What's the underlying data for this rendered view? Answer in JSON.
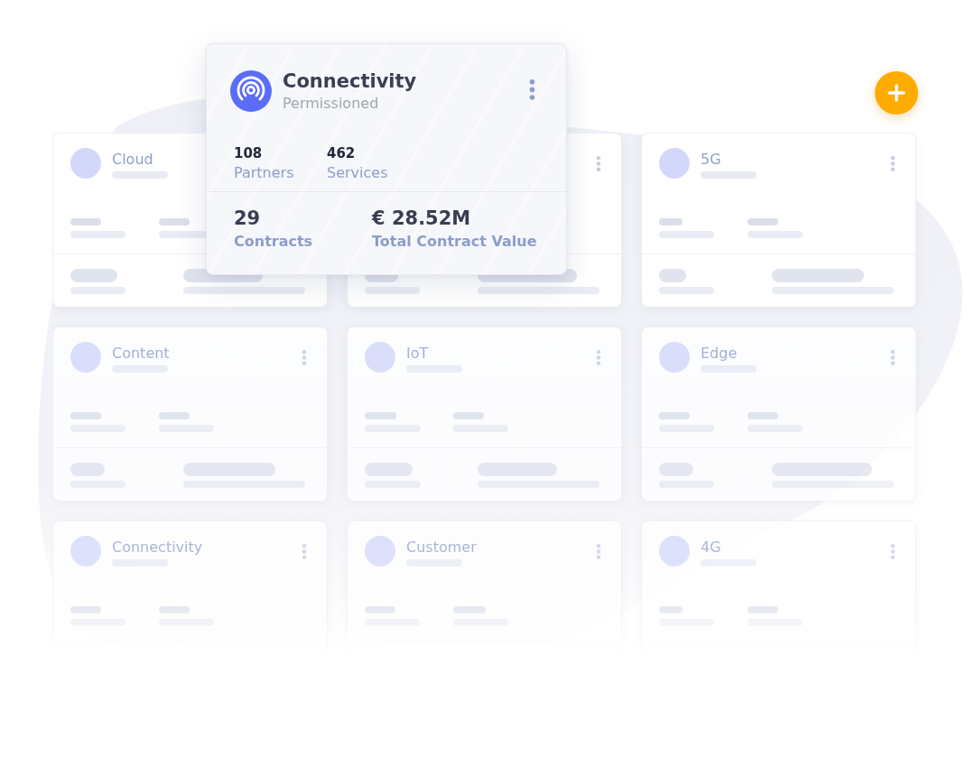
{
  "featured_card": {
    "title": "Connectivity",
    "subtitle": "Permissioned",
    "stats": [
      {
        "value": "108",
        "label": "Partners"
      },
      {
        "value": "462",
        "label": "Services"
      }
    ],
    "totals": [
      {
        "value": "29",
        "label": "Contracts"
      },
      {
        "value": "€ 28.52M",
        "label": "Total Contract Value"
      }
    ]
  },
  "cards": [
    {
      "title": "Cloud"
    },
    {
      "title": "5G"
    },
    {
      "title": "Content"
    },
    {
      "title": "IoT"
    },
    {
      "title": "Edge"
    },
    {
      "title": "Connectivity"
    },
    {
      "title": "Customer"
    },
    {
      "title": "4G"
    }
  ]
}
